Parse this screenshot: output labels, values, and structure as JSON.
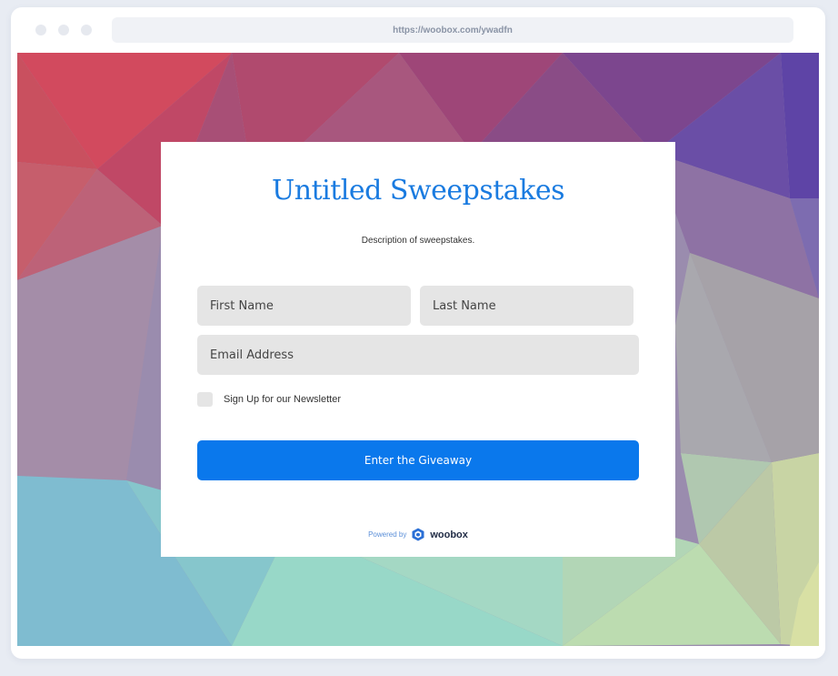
{
  "browser": {
    "url": "https://woobox.com/ywadfn"
  },
  "form": {
    "title": "Untitled Sweepstakes",
    "description": "Description of sweepstakes.",
    "first_name_placeholder": "First Name",
    "last_name_placeholder": "Last Name",
    "email_placeholder": "Email Address",
    "newsletter_label": "Sign Up for our Newsletter",
    "newsletter_checked": false,
    "submit_label": "Enter the Giveaway"
  },
  "footer": {
    "powered_by": "Powered by",
    "brand": "woobox",
    "brand_icon": "woobox-logo-icon"
  },
  "colors": {
    "accent": "#0a78ec",
    "title": "#1a7be0",
    "field_bg": "#e5e5e5"
  }
}
